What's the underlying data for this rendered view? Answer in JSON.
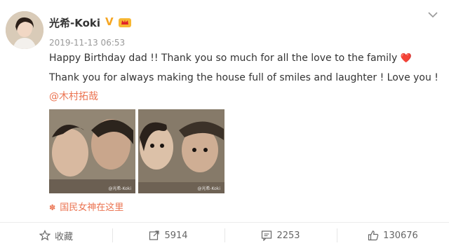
{
  "user": {
    "name": "光希-Koki",
    "verified_badge": "V"
  },
  "post": {
    "timestamp": "2019-11-13 06:53",
    "line1": "Happy Birthday dad !!  Thank you so much for all the love to the family",
    "line1_emoji": "❤️",
    "line2": "Thank you for always making the house full of smiles and laughter ! Love you !",
    "mention": "@木村拓哉",
    "location": "国民女神在这里",
    "image_watermark": "@光希-Koki"
  },
  "actions": {
    "collect": "收藏",
    "repost_count": "5914",
    "comment_count": "2253",
    "like_count": "130676"
  },
  "colors": {
    "accent": "#eb7350",
    "badge": "#f5a623",
    "heart": "#e0222a"
  }
}
